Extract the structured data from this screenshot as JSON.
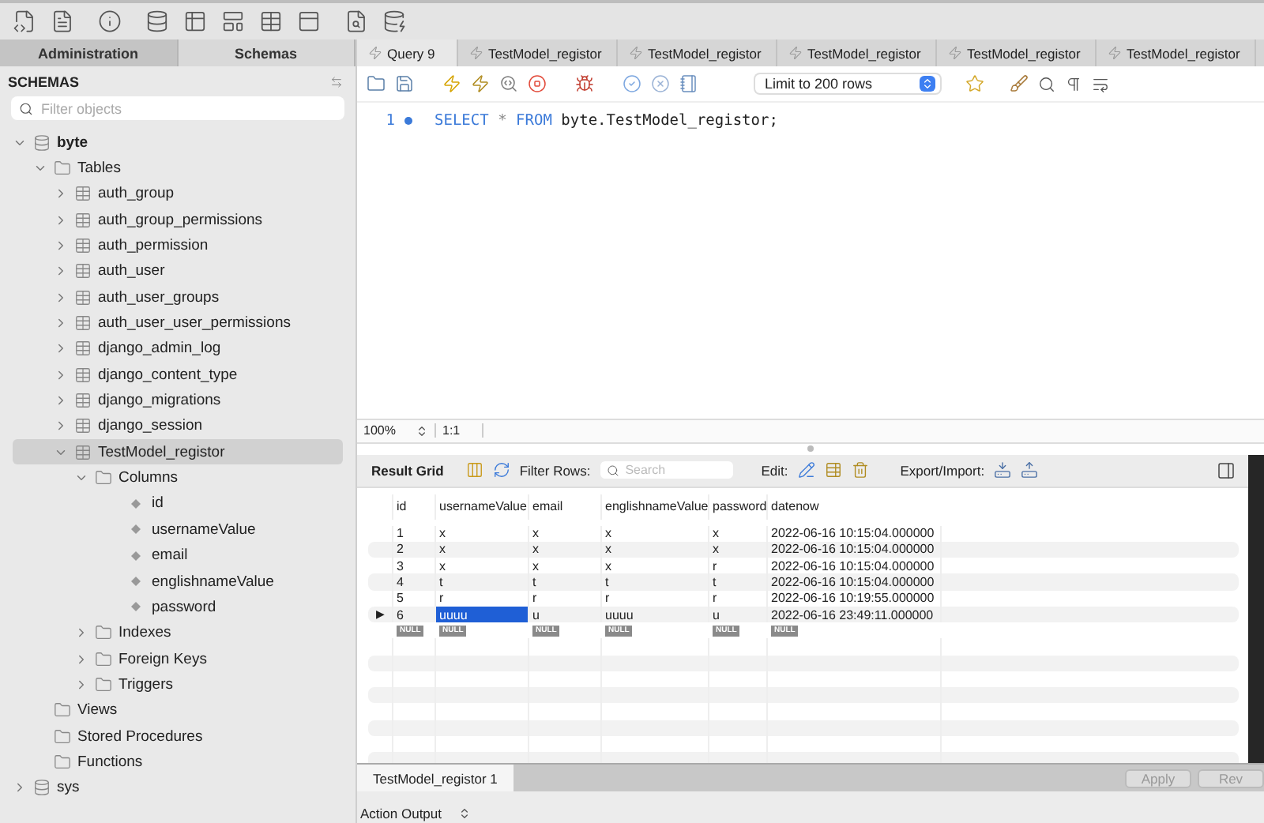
{
  "side_tabs": [
    {
      "label": "Administration",
      "selected": false
    },
    {
      "label": "Schemas",
      "selected": true
    }
  ],
  "sidebar": {
    "title": "SCHEMAS",
    "filter": {
      "placeholder": "Filter objects"
    },
    "tree": [
      {
        "label": "byte",
        "kind": "schema",
        "expanded": true,
        "selected": false,
        "children": [
          {
            "label": "Tables",
            "kind": "folder",
            "expanded": true,
            "selected": false,
            "children": [
              {
                "label": "auth_group",
                "kind": "table",
                "expanded": false,
                "selected": false
              },
              {
                "label": "auth_group_permissions",
                "kind": "table",
                "expanded": false,
                "selected": false
              },
              {
                "label": "auth_permission",
                "kind": "table",
                "expanded": false,
                "selected": false
              },
              {
                "label": "auth_user",
                "kind": "table",
                "expanded": false,
                "selected": false
              },
              {
                "label": "auth_user_groups",
                "kind": "table",
                "expanded": false,
                "selected": false
              },
              {
                "label": "auth_user_user_permissions",
                "kind": "table",
                "expanded": false,
                "selected": false
              },
              {
                "label": "django_admin_log",
                "kind": "table",
                "expanded": false,
                "selected": false
              },
              {
                "label": "django_content_type",
                "kind": "table",
                "expanded": false,
                "selected": false
              },
              {
                "label": "django_migrations",
                "kind": "table",
                "expanded": false,
                "selected": false
              },
              {
                "label": "django_session",
                "kind": "table",
                "expanded": false,
                "selected": false
              },
              {
                "label": "TestModel_registor",
                "kind": "table",
                "expanded": true,
                "selected": true,
                "children": [
                  {
                    "label": "Columns",
                    "kind": "folder",
                    "expanded": true,
                    "selected": false,
                    "children": [
                      {
                        "label": "id",
                        "kind": "column",
                        "selected": false
                      },
                      {
                        "label": "usernameValue",
                        "kind": "column",
                        "selected": false
                      },
                      {
                        "label": "email",
                        "kind": "column",
                        "selected": false
                      },
                      {
                        "label": "englishnameValue",
                        "kind": "column",
                        "selected": false
                      },
                      {
                        "label": "password",
                        "kind": "column",
                        "selected": false
                      }
                    ]
                  },
                  {
                    "label": "Indexes",
                    "kind": "folder",
                    "expanded": false,
                    "selected": false
                  },
                  {
                    "label": "Foreign Keys",
                    "kind": "folder",
                    "expanded": false,
                    "selected": false
                  },
                  {
                    "label": "Triggers",
                    "kind": "folder",
                    "expanded": false,
                    "selected": false
                  }
                ]
              }
            ]
          },
          {
            "label": "Views",
            "kind": "folder",
            "selected": false
          },
          {
            "label": "Stored Procedures",
            "kind": "folder",
            "selected": false
          },
          {
            "label": "Functions",
            "kind": "folder",
            "selected": false
          }
        ]
      },
      {
        "label": "sys",
        "kind": "schema",
        "expanded": false,
        "selected": false
      }
    ]
  },
  "query_tabs": [
    {
      "label": "Query 9",
      "selected": true
    },
    {
      "label": "TestModel_registor",
      "selected": false
    },
    {
      "label": "TestModel_registor",
      "selected": false
    },
    {
      "label": "TestModel_registor",
      "selected": false
    },
    {
      "label": "TestModel_registor",
      "selected": false
    },
    {
      "label": "TestModel_registor",
      "selected": false
    }
  ],
  "editor": {
    "limit": "Limit to 200 rows",
    "lines": [
      {
        "number": "1",
        "tokens": [
          {
            "kind": "keyword",
            "text": "SELECT"
          },
          {
            "kind": "operator",
            "text": "*"
          },
          {
            "kind": "keyword",
            "text": "FROM"
          },
          {
            "kind": "schema",
            "text": "byte.TestModel_registor;"
          }
        ]
      }
    ]
  },
  "status": {
    "zoom": "100%",
    "position": "1:1"
  },
  "result": {
    "title": "Result Grid",
    "filter_label": "Filter Rows:",
    "search_placeholder": "Search",
    "edit_label": "Edit:",
    "export_label": "Export/Import:",
    "columns": [
      "id",
      "usernameValue",
      "email",
      "englishnameValue",
      "password",
      "datenow"
    ],
    "rows": [
      {
        "current": false,
        "cells": [
          {
            "text": "1",
            "selected": false
          },
          {
            "text": "x",
            "selected": false
          },
          {
            "text": "x",
            "selected": false
          },
          {
            "text": "x",
            "selected": false
          },
          {
            "text": "x",
            "selected": false
          },
          {
            "text": "2022-06-16 10:15:04.000000",
            "selected": false
          }
        ]
      },
      {
        "current": false,
        "cells": [
          {
            "text": "2",
            "selected": false
          },
          {
            "text": "x",
            "selected": false
          },
          {
            "text": "x",
            "selected": false
          },
          {
            "text": "x",
            "selected": false
          },
          {
            "text": "x",
            "selected": false
          },
          {
            "text": "2022-06-16 10:15:04.000000",
            "selected": false
          }
        ]
      },
      {
        "current": false,
        "cells": [
          {
            "text": "3",
            "selected": false
          },
          {
            "text": "x",
            "selected": false
          },
          {
            "text": "x",
            "selected": false
          },
          {
            "text": "x",
            "selected": false
          },
          {
            "text": "r",
            "selected": false
          },
          {
            "text": "2022-06-16 10:15:04.000000",
            "selected": false
          }
        ]
      },
      {
        "current": false,
        "cells": [
          {
            "text": "4",
            "selected": false
          },
          {
            "text": "t",
            "selected": false
          },
          {
            "text": "t",
            "selected": false
          },
          {
            "text": "t",
            "selected": false
          },
          {
            "text": "t",
            "selected": false
          },
          {
            "text": "2022-06-16 10:15:04.000000",
            "selected": false
          }
        ]
      },
      {
        "current": false,
        "cells": [
          {
            "text": "5",
            "selected": false
          },
          {
            "text": "r",
            "selected": false
          },
          {
            "text": "r",
            "selected": false
          },
          {
            "text": "r",
            "selected": false
          },
          {
            "text": "r",
            "selected": false
          },
          {
            "text": "2022-06-16 10:19:55.000000",
            "selected": false
          }
        ]
      },
      {
        "current": true,
        "cells": [
          {
            "text": "6",
            "selected": false
          },
          {
            "text": "uuuu",
            "selected": true
          },
          {
            "text": "u",
            "selected": false
          },
          {
            "text": "uuuu",
            "selected": false
          },
          {
            "text": "u",
            "selected": false
          },
          {
            "text": "2022-06-16 23:49:11.000000",
            "selected": false
          }
        ]
      }
    ],
    "current_marker": "▶",
    "new_row": [
      "NULL",
      "NULL",
      "NULL",
      "NULL",
      "NULL",
      "NULL"
    ]
  },
  "result_tabs": [
    {
      "label": "TestModel_registor 1",
      "selected": true
    }
  ],
  "result_buttons": [
    {
      "label": "Apply",
      "disabled": true
    },
    {
      "label": "Rev",
      "disabled": true
    }
  ],
  "output": {
    "label": "Action Output"
  }
}
